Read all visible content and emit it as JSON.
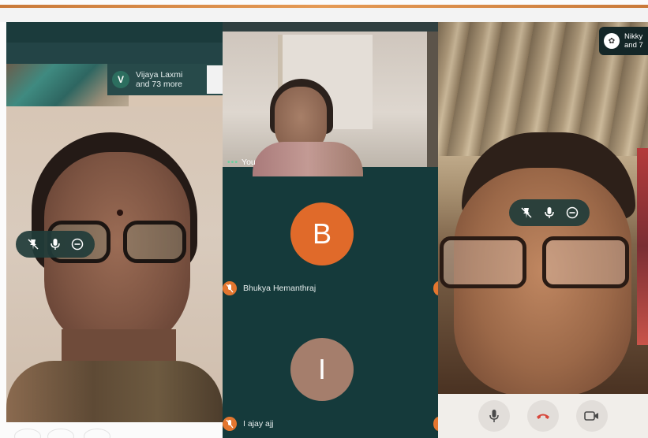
{
  "left_tile": {
    "overflow_chip_letter": "V",
    "overflow_line1": "Vijaya Laxmi",
    "overflow_line2": "and 73 more"
  },
  "middle_tile": {
    "self_label": "You",
    "participants": [
      {
        "avatar_letter": "B",
        "name": "Bhukya Hemanthraj",
        "avatar_color": "#e06a2a"
      },
      {
        "avatar_letter": "I",
        "name": "I ajay ajj",
        "avatar_color": "#a57e6c"
      }
    ]
  },
  "right_tile": {
    "name_line1": "Nikky",
    "name_line2": "and 7"
  },
  "controls": {
    "tile_pill_icons": [
      "pin-icon",
      "mic-icon",
      "remove-icon"
    ],
    "bottom_bar_icons": [
      "mic-icon",
      "end-call-icon",
      "camera-icon"
    ]
  },
  "colors": {
    "accent_orange": "#e3762f",
    "call_end_red": "#d8473b",
    "panel_dark": "#153a3b"
  }
}
